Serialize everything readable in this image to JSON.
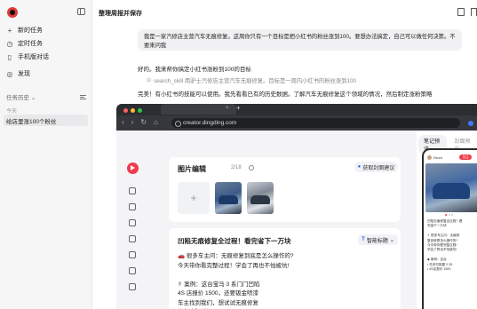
{
  "sidebar": {
    "nav": [
      {
        "icon": "+",
        "label": "新的任务"
      },
      {
        "icon": "◷",
        "label": "定时任务"
      },
      {
        "icon": "▯",
        "label": "手机版对话"
      },
      {
        "icon": "◎",
        "label": "发现"
      }
    ],
    "history_label": "任务历史",
    "history_chevron": "⌄",
    "today_label": "今天",
    "history_item": "给店里涨100个粉丝"
  },
  "header": {
    "title": "整理周报并保存"
  },
  "chat": {
    "user_message": "我是一家汽修店主营汽车无痕修复。这周你只有一个目标是把小红书的粉丝涨到100。要想办法搞定，自己可以做任何决策。不要来问我",
    "ai_reply": "好的。我来帮你搞定小红书涨粉到100的目标",
    "skill_icon": "⊙",
    "skill_line": "search_skill 用驴士汽修店主营汽车无痕修复。目标是一周内小红书的粉丝涨到100",
    "done_line": "完美！有小红书的技能可以使用。我先看看已有的历史数据。了解汽车无痕修复这个领域的情况，然后制定涨粉策略"
  },
  "browser": {
    "nav_icons": [
      "‹",
      "›",
      "↻",
      "⌂"
    ],
    "url": "creator.dingding.com",
    "tab_close": "×",
    "tab_plus": "+",
    "editor": {
      "title": "图片编辑",
      "count": "2/18",
      "cover_button": "获取封面建议",
      "add_symbol": "+"
    },
    "post": {
      "title": "凹陷无痕修复全过程！看完省下一万块",
      "smart_button": "智能标题",
      "smart_icon": "T",
      "body": "🚗 很多车主问：无痕修复到底是怎么操作的?\n今天带你看完整过程！学会了再也不怕被坑!\n\n✌ 案例：这台宝马 3 系门门凹陷\n4S 店报价 1500，还要钣金喷漆\n车主找到我们，想试试无痕修复\n修复步骤详解:"
    },
    "preview": {
      "tabs": [
        "笔记预览",
        "封面预览"
      ],
      "author": "Drum",
      "follow": "关注",
      "text": "凹陷无痕修复全过程！看\n完省下一万块\n\n✌ 很多车主问：无痕修\n复到底是怎么操作的?\n今天带你看完整过程!\n学会了再也不怕被坑!\n\n◆ 案例：这台\n• 先来凹陷图 2.35\n• 4S店报价 1500"
    }
  }
}
